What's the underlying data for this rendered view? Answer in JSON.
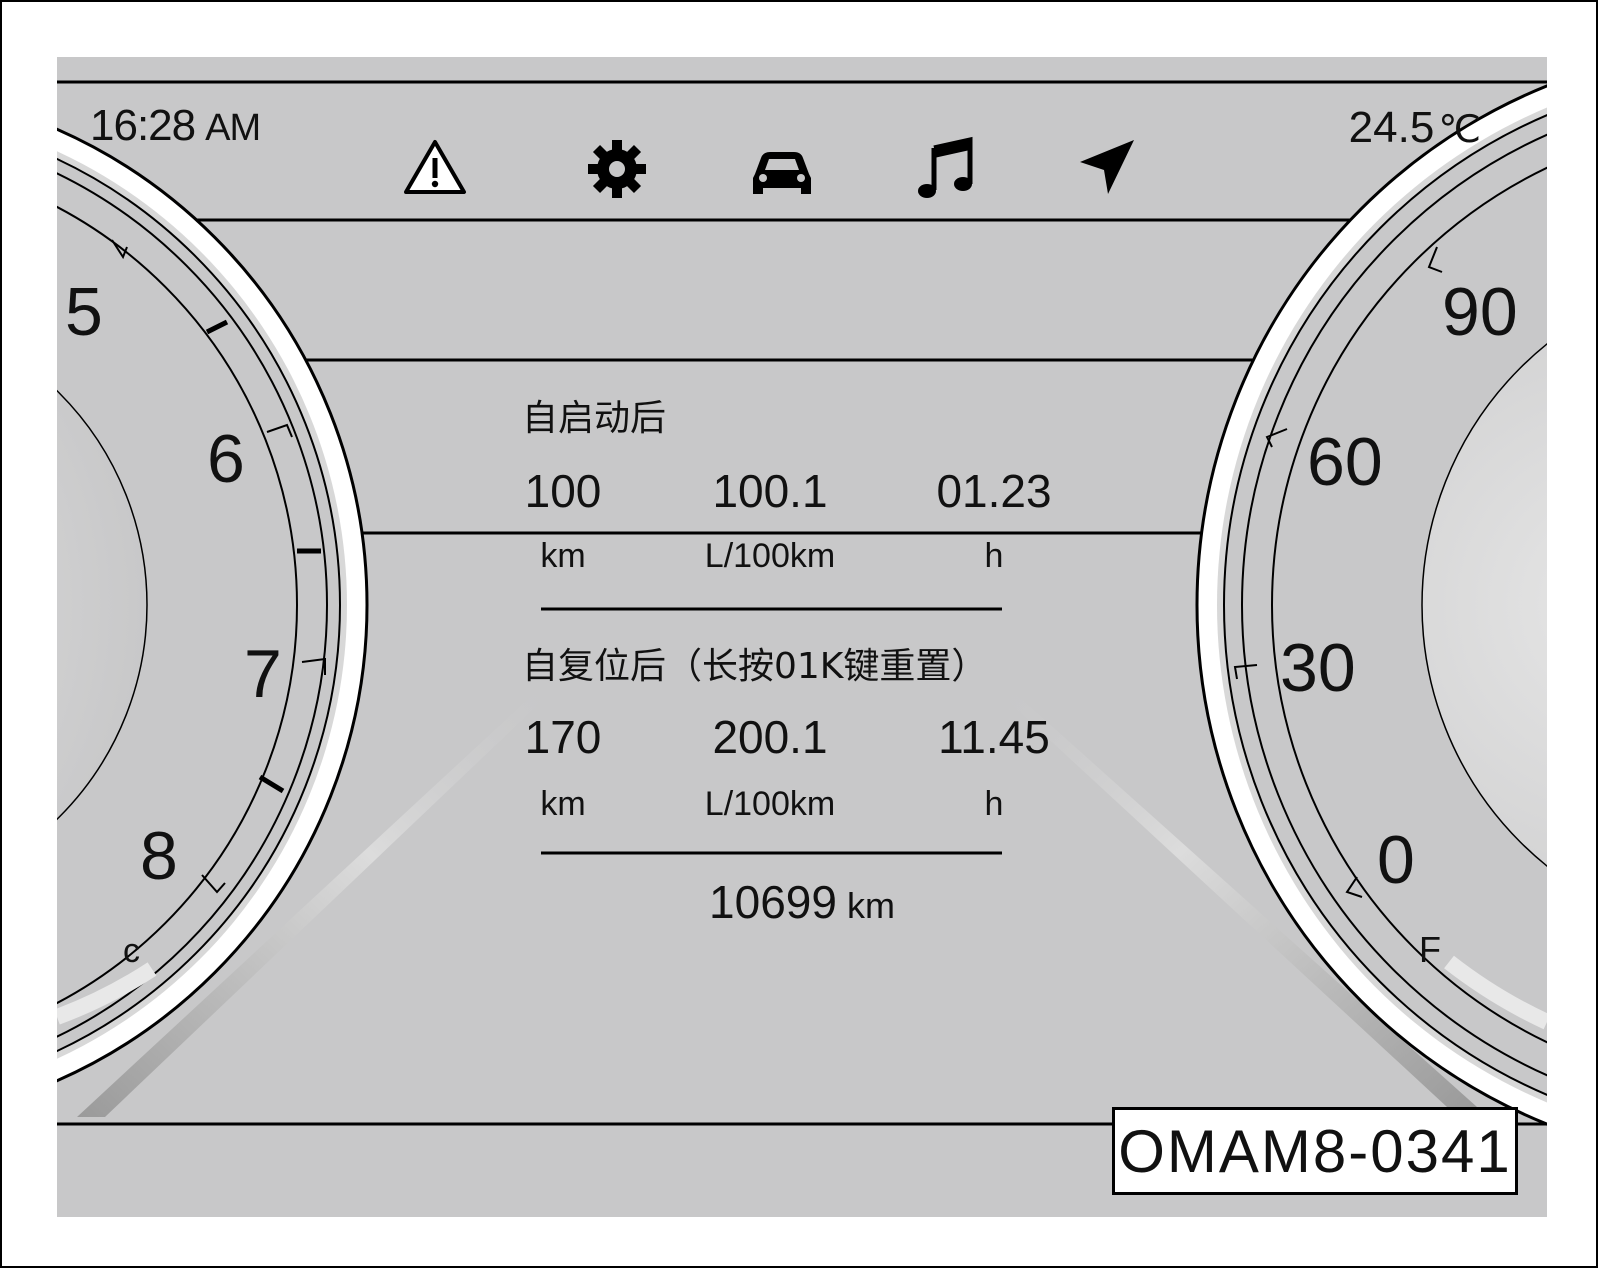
{
  "status_bar": {
    "time": "16:28",
    "time_suffix": "AM",
    "temperature": "24.5",
    "temperature_unit": "℃"
  },
  "icons": [
    "warning-icon",
    "settings-gear-icon",
    "car-icon",
    "music-note-icon",
    "navigation-arrow-icon"
  ],
  "left_gauge": {
    "labels": [
      "5",
      "6",
      "7",
      "8",
      "C"
    ]
  },
  "right_gauge": {
    "labels": [
      "90",
      "60",
      "30",
      "0",
      "F"
    ]
  },
  "trip_since_start": {
    "title": "自启动后",
    "distance": "100",
    "distance_unit": "km",
    "fuel_consumption": "100.1",
    "fuel_consumption_unit": "L/100km",
    "duration": "01.23",
    "duration_unit": "h"
  },
  "trip_since_reset": {
    "title": "自复位后（长按01K键重置）",
    "distance": "170",
    "distance_unit": "km",
    "fuel_consumption": "200.1",
    "fuel_consumption_unit": "L/100km",
    "duration": "11.45",
    "duration_unit": "h"
  },
  "odometer": {
    "value": "10699",
    "unit": "km"
  },
  "figure_code": "OMAM8-0341",
  "colors": {
    "screen_background": "#c8c8c9",
    "ink": "#111111"
  }
}
